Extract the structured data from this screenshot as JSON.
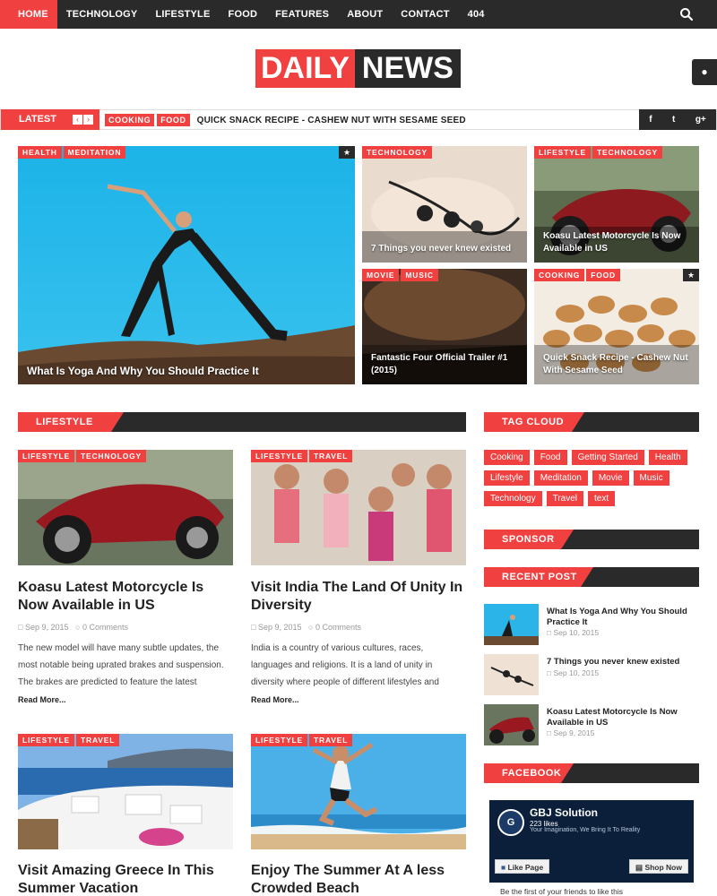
{
  "nav": {
    "items": [
      "HOME",
      "TECHNOLOGY",
      "LIFESTYLE",
      "FOOD",
      "FEATURES",
      "ABOUT",
      "CONTACT",
      "404"
    ]
  },
  "logo": {
    "part1": "DAILY",
    "part2": "NEWS"
  },
  "ticker": {
    "label": "LATEST",
    "tags": [
      "COOKING",
      "FOOD"
    ],
    "headline": "QUICK SNACK RECIPE - CASHEW NUT WITH SESAME SEED",
    "social": [
      "f",
      "t",
      "g+"
    ]
  },
  "featured": [
    {
      "tags": [
        "HEALTH",
        "MEDITATION"
      ],
      "title": "What Is Yoga And Why You Should Practice It"
    },
    {
      "tags": [
        "TECHNOLOGY"
      ],
      "title": "7 Things you never knew existed"
    },
    {
      "tags": [
        "LIFESTYLE",
        "TECHNOLOGY"
      ],
      "title": "Koasu Latest Motorcycle Is Now Available in US"
    },
    {
      "tags": [
        "MOVIE",
        "MUSIC"
      ],
      "title": "Fantastic Four Official Trailer #1 (2015)"
    },
    {
      "tags": [
        "COOKING",
        "FOOD"
      ],
      "title": "Quick Snack Recipe - Cashew Nut With Sesame Seed"
    }
  ],
  "sections": {
    "lifestyle": "LIFESTYLE",
    "tag_cloud": "TAG CLOUD",
    "sponsor": "SPONSOR",
    "recent_post": "RECENT POST",
    "facebook": "FACEBOOK"
  },
  "posts": [
    {
      "tags": [
        "LIFESTYLE",
        "TECHNOLOGY"
      ],
      "title": "Koasu Latest Motorcycle Is Now Available in US",
      "date": "Sep 9, 2015",
      "comments": "0 Comments",
      "excerpt": "The new model will have many subtle updates, the most notable being uprated brakes and suspension. The brakes are predicted to feature the latest",
      "read_more": "Read More..."
    },
    {
      "tags": [
        "LIFESTYLE",
        "TRAVEL"
      ],
      "title": "Visit India The Land Of Unity In Diversity",
      "date": "Sep 9, 2015",
      "comments": "0 Comments",
      "excerpt": "India is a country of various cultures, races, languages and religions. It is a land of unity in diversity where people of different lifestyles and manners live",
      "read_more": "Read More..."
    },
    {
      "tags": [
        "LIFESTYLE",
        "TRAVEL"
      ],
      "title": "Visit Amazing Greece In This Summer Vacation"
    },
    {
      "tags": [
        "LIFESTYLE",
        "TRAVEL"
      ],
      "title": "Enjoy The Summer At A less Crowded Beach"
    }
  ],
  "tag_cloud": [
    "Cooking",
    "Food",
    "Getting Started",
    "Health",
    "Lifestyle",
    "Meditation",
    "Movie",
    "Music",
    "Technology",
    "Travel",
    "text"
  ],
  "recent_posts": [
    {
      "title": "What Is Yoga And Why You Should Practice It",
      "date": "Sep 10, 2015"
    },
    {
      "title": "7 Things you never knew existed",
      "date": "Sep 10, 2015"
    },
    {
      "title": "Koasu Latest Motorcycle Is Now Available in US",
      "date": "Sep 9, 2015"
    }
  ],
  "facebook": {
    "page_name": "GBJ Solution",
    "likes": "223 likes",
    "tagline": "Your Imagination, We Bring It To Reality",
    "like_button": "Like Page",
    "shop_button": "Shop Now",
    "note": "Be the first of your friends to like this"
  },
  "colors": {
    "accent": "#f04040",
    "dark": "#2a2a2a"
  }
}
